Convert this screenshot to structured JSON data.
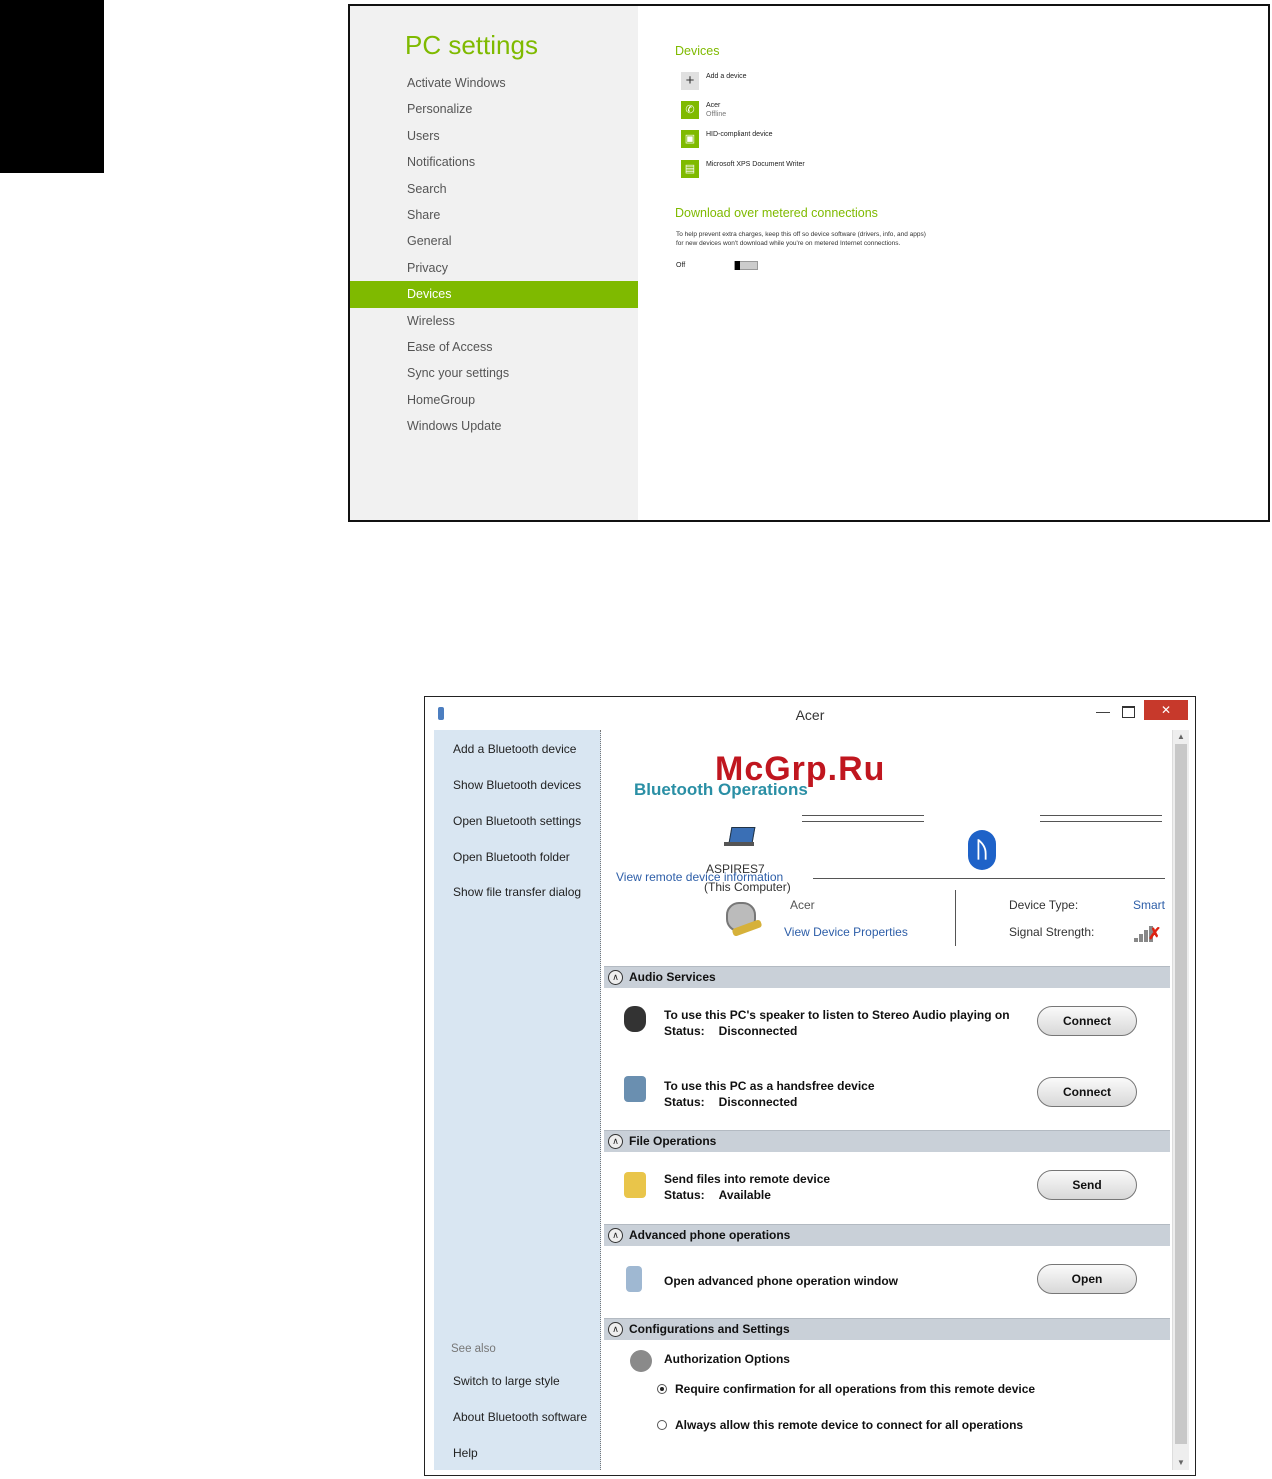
{
  "pc_settings": {
    "title": "PC settings",
    "nav": [
      "Activate Windows",
      "Personalize",
      "Users",
      "Notifications",
      "Search",
      "Share",
      "General",
      "Privacy",
      "Devices",
      "Wireless",
      "Ease of Access",
      "Sync your settings",
      "HomeGroup",
      "Windows Update"
    ],
    "active": "Devices",
    "devices_heading": "Devices",
    "devices": [
      {
        "name": "Add a device",
        "sub": "",
        "icon": "plus-icon"
      },
      {
        "name": "Acer",
        "sub": "Offline",
        "icon": "phone-icon"
      },
      {
        "name": "HID-compliant device",
        "sub": "",
        "icon": "hid-device-icon"
      },
      {
        "name": "Microsoft XPS Document Writer",
        "sub": "",
        "icon": "printer-document-icon"
      }
    ],
    "metered_heading": "Download over metered connections",
    "metered_text": "To help prevent extra charges, keep this off so device software (drivers, info, and apps) for new devices won't download while you're on metered Internet connections.",
    "metered_state": "Off",
    "accent": "#7fba00"
  },
  "bluetooth": {
    "window_title": "Acer",
    "watermark": "McGrp.Ru",
    "sidebar": {
      "links": [
        "Add a Bluetooth device",
        "Show Bluetooth devices",
        "Open Bluetooth settings",
        "Open Bluetooth folder",
        "Show file transfer dialog"
      ],
      "see_also": "See also",
      "see_also_links": [
        "Switch to large style",
        "About Bluetooth software",
        "Help"
      ]
    },
    "heading": "Bluetooth Operations",
    "computer_name": "ASPIRES7",
    "computer_sub": "(This Computer)",
    "view_remote_info": "View remote device information",
    "remote_name": "Acer",
    "view_device_properties": "View Device Properties",
    "device_type_label": "Device Type:",
    "device_type_value": "Smart",
    "signal_label": "Signal Strength:",
    "sections": {
      "audio": {
        "title": "Audio Services",
        "items": [
          {
            "text": "To use this PC's speaker to listen to Stereo Audio playing on",
            "status_label": "Status:",
            "status": "Disconnected",
            "button": "Connect"
          },
          {
            "text": "To use this PC as a handsfree device",
            "status_label": "Status:",
            "status": "Disconnected",
            "button": "Connect"
          }
        ]
      },
      "file": {
        "title": "File Operations",
        "text": "Send files into remote device",
        "status_label": "Status:",
        "status": "Available",
        "button": "Send"
      },
      "phone": {
        "title": "Advanced phone operations",
        "text": "Open advanced phone operation window",
        "button": "Open"
      },
      "config": {
        "title": "Configurations and Settings",
        "auth_title": "Authorization Options",
        "options": [
          "Require confirmation for all operations from this remote device",
          "Always allow this remote device to connect for all operations"
        ],
        "selected_index": 0
      }
    }
  }
}
